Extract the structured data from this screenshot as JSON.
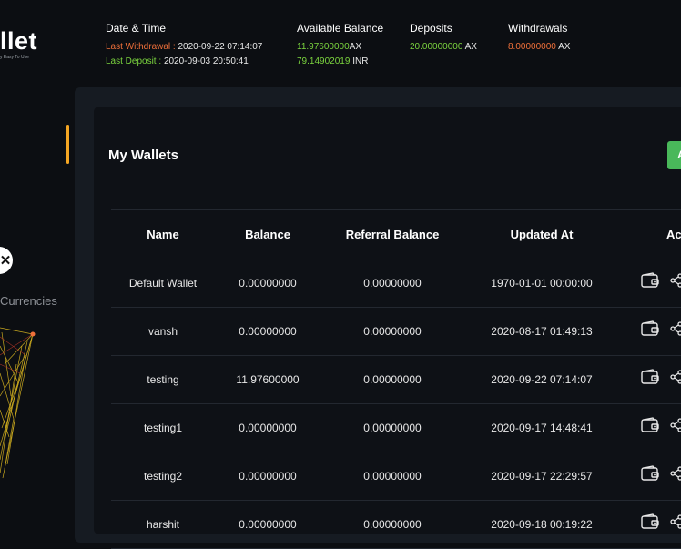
{
  "brand": {
    "logo_text": "llet",
    "tagline": "y Easy To Use"
  },
  "header": {
    "datetime": {
      "title": "Date & Time",
      "last_withdrawal_label": "Last Withdrawal :",
      "last_withdrawal_value": "2020-09-22 07:14:07",
      "last_deposit_label": "Last Deposit :",
      "last_deposit_value": "2020-09-03 20:50:41"
    },
    "balance": {
      "title": "Available Balance",
      "ax_amount": "11.97600000",
      "ax_unit": "AX",
      "inr_amount": "79.14902019",
      "inr_unit": "INR"
    },
    "deposits": {
      "title": "Deposits",
      "amount": "20.00000000",
      "unit": "AX"
    },
    "withdrawals": {
      "title": "Withdrawals",
      "amount": "8.00000000",
      "unit": "AX"
    }
  },
  "sidebar": {
    "currencies_label": "Currencies"
  },
  "wallets": {
    "title": "My Wallets",
    "add_button_label": "A",
    "columns": [
      "Name",
      "Balance",
      "Referral Balance",
      "Updated At",
      "Ac"
    ],
    "rows": [
      {
        "name": "Default Wallet",
        "balance": "0.00000000",
        "referral": "0.00000000",
        "updated": "1970-01-01 00:00:00"
      },
      {
        "name": "vansh",
        "balance": "0.00000000",
        "referral": "0.00000000",
        "updated": "2020-08-17 01:49:13"
      },
      {
        "name": "testing",
        "balance": "11.97600000",
        "referral": "0.00000000",
        "updated": "2020-09-22 07:14:07"
      },
      {
        "name": "testing1",
        "balance": "0.00000000",
        "referral": "0.00000000",
        "updated": "2020-09-17 14:48:41"
      },
      {
        "name": "testing2",
        "balance": "0.00000000",
        "referral": "0.00000000",
        "updated": "2020-09-17 22:29:57"
      },
      {
        "name": "harshit",
        "balance": "0.00000000",
        "referral": "0.00000000",
        "updated": "2020-09-18 00:19:22"
      }
    ],
    "row_icons": [
      "wallet-icon",
      "share-icon"
    ]
  },
  "colors": {
    "accent_orange": "#f0703a",
    "accent_green": "#7bd43e",
    "button_green": "#49b85a",
    "nav_accent": "#f5a623",
    "graph_yellow": "#e6c021"
  }
}
